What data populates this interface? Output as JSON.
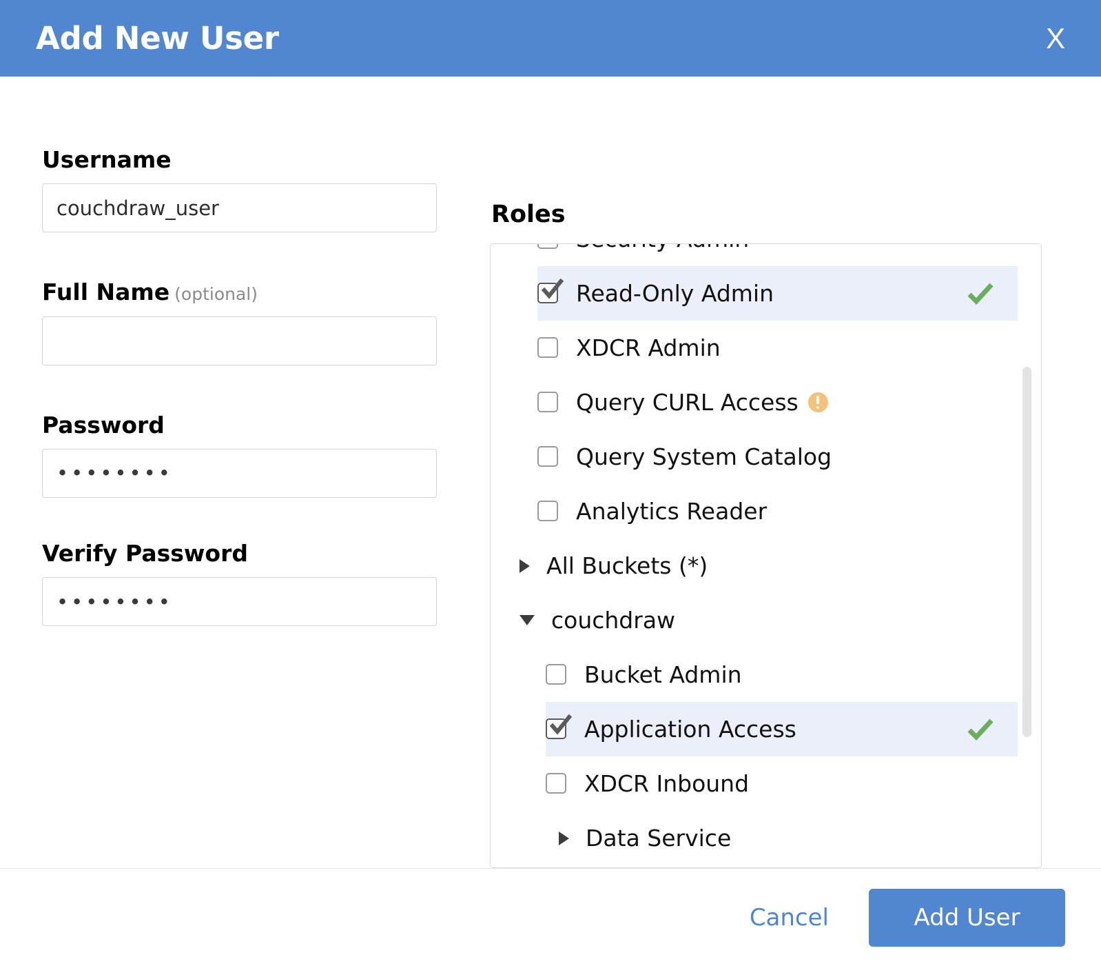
{
  "header": {
    "title": "Add New User",
    "close_label": "X",
    "background_color": "#5186d1"
  },
  "form": {
    "username": {
      "label": "Username",
      "value": "couchdraw_user",
      "placeholder": ""
    },
    "full_name": {
      "label": "Full Name",
      "optional_note": "(optional)",
      "value": "",
      "placeholder": ""
    },
    "password": {
      "label": "Password",
      "value": "••••••••",
      "placeholder": ""
    },
    "verify_password": {
      "label": "Verify Password",
      "value": "••••••••",
      "placeholder": ""
    }
  },
  "roles": {
    "title": "Roles",
    "selected_row_color": "#eaeffa",
    "check_color": "#6aae5c",
    "warning_color": "#f2c27b",
    "items": [
      {
        "label": "Security Admin",
        "checked": false,
        "selected": false,
        "warning": false,
        "clipped": true
      },
      {
        "label": "Read-Only Admin",
        "checked": true,
        "selected": true,
        "warning": false
      },
      {
        "label": "XDCR Admin",
        "checked": false,
        "selected": false,
        "warning": false
      },
      {
        "label": "Query CURL Access",
        "checked": false,
        "selected": false,
        "warning": true
      },
      {
        "label": "Query System Catalog",
        "checked": false,
        "selected": false,
        "warning": false
      },
      {
        "label": "Analytics Reader",
        "checked": false,
        "selected": false,
        "warning": false
      }
    ],
    "tree": [
      {
        "label": "All Buckets (*)",
        "expanded": false,
        "level": 1
      },
      {
        "label": "couchdraw",
        "expanded": true,
        "level": 1
      }
    ],
    "bucket_items": [
      {
        "label": "Bucket Admin",
        "checked": false,
        "selected": false
      },
      {
        "label": "Application Access",
        "checked": true,
        "selected": true
      },
      {
        "label": "XDCR Inbound",
        "checked": false,
        "selected": false
      }
    ],
    "sub_tree": [
      {
        "label": "Data Service",
        "expanded": false,
        "level": 2
      }
    ]
  },
  "footer": {
    "cancel_label": "Cancel",
    "add_user_label": "Add User",
    "button_color": "#5186d1"
  }
}
